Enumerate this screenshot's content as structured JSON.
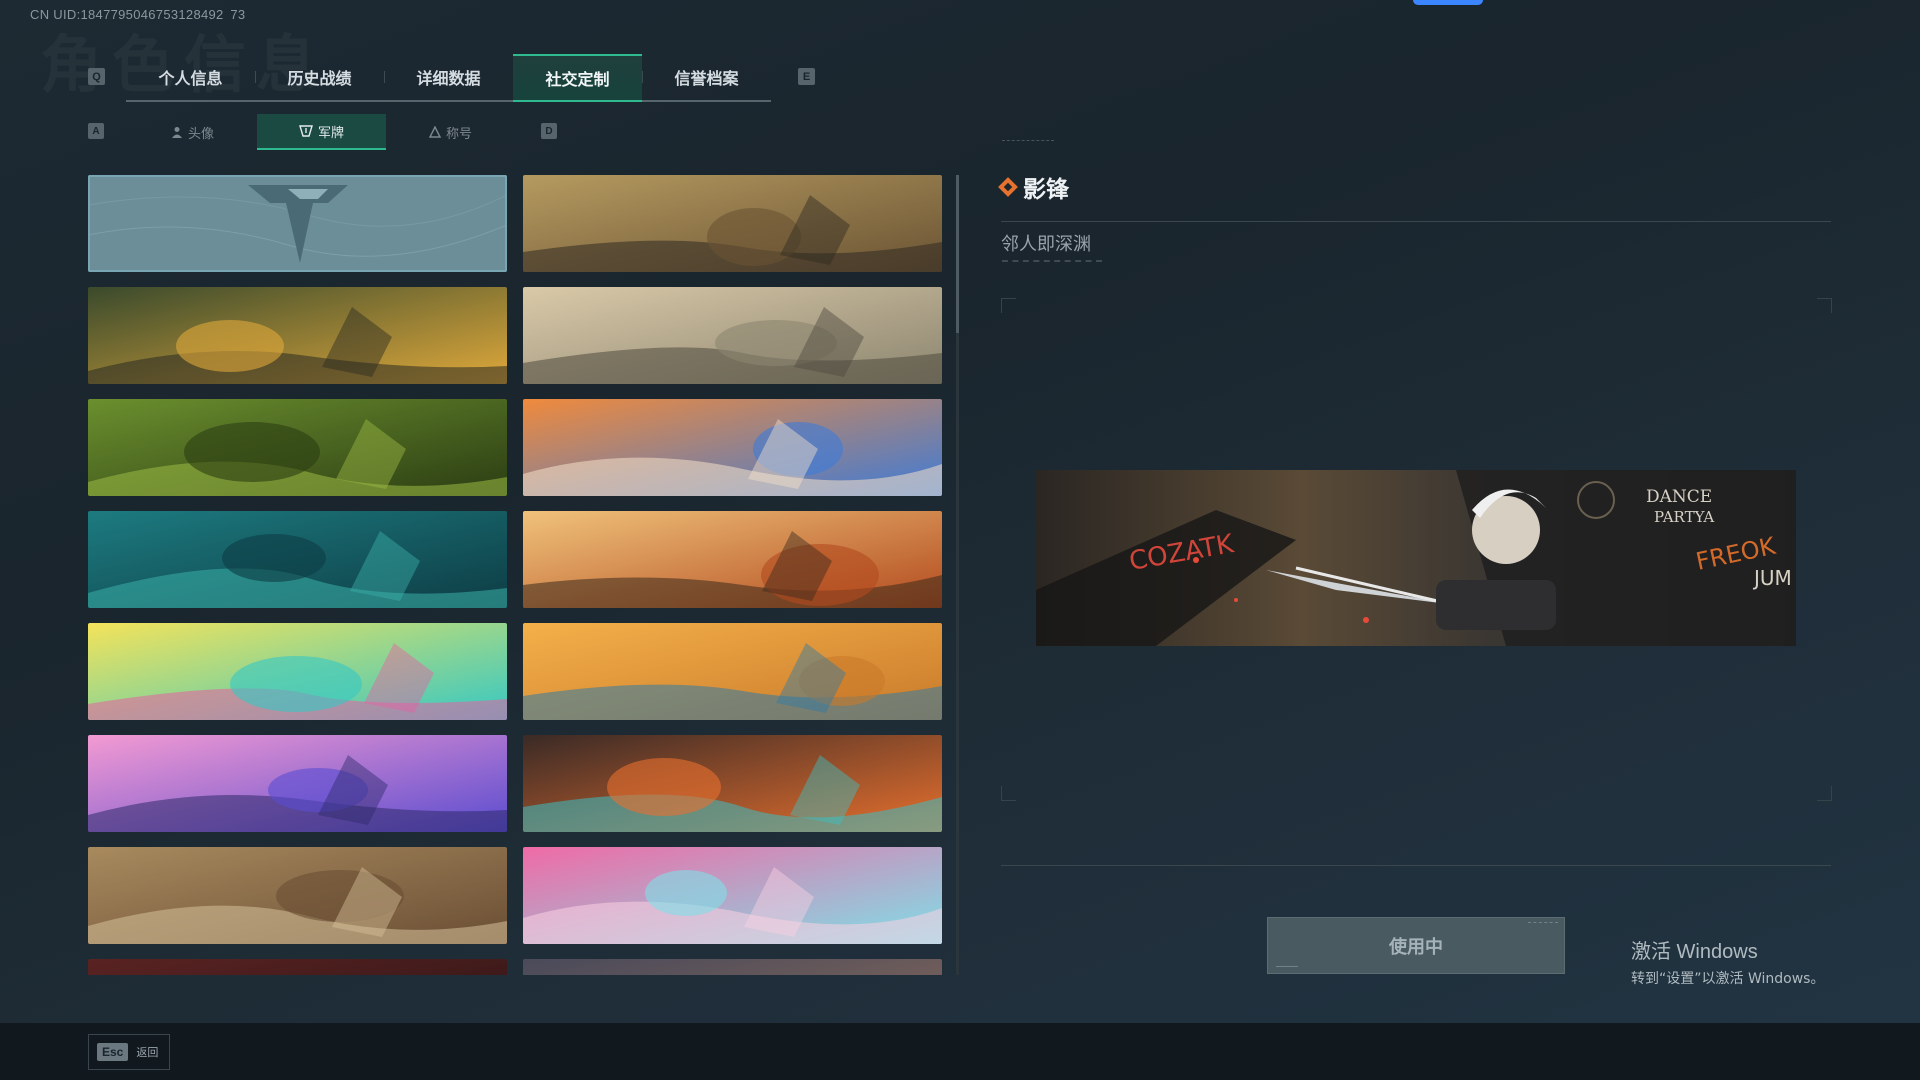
{
  "uid": "CN UID:1847795046753128492 73",
  "ghost_title": "角色信息",
  "tabs": {
    "left_key": "Q",
    "right_key": "E",
    "items": [
      {
        "label": "个人信息"
      },
      {
        "label": "历史战绩"
      },
      {
        "label": "详细数据"
      },
      {
        "label": "社交定制"
      },
      {
        "label": "信誉档案"
      }
    ],
    "active_index": 3
  },
  "subtabs": {
    "left_key": "A",
    "right_key": "D",
    "items": [
      {
        "label": "头像",
        "icon": "person-icon"
      },
      {
        "label": "军牌",
        "icon": "badge-icon"
      },
      {
        "label": "称号",
        "icon": "title-icon"
      }
    ],
    "active_index": 1
  },
  "cards": [
    {
      "theme": "tactical-logo",
      "c1": "#6c8e99",
      "c2": "#4a6a76",
      "c3": "#8fb0b8"
    },
    {
      "theme": "helicopter-desert",
      "c1": "#b59a5f",
      "c2": "#6a5334",
      "c3": "#2f2a22"
    },
    {
      "theme": "weapons-table",
      "c1": "#3a4a2c",
      "c2": "#e0a93b",
      "c3": "#2a2a22"
    },
    {
      "theme": "sniper-sunset",
      "c1": "#d9c9a8",
      "c2": "#8c8570",
      "c3": "#4e4a3e"
    },
    {
      "theme": "night-vision",
      "c1": "#6b8f2e",
      "c2": "#2b3d13",
      "c3": "#9dbb45"
    },
    {
      "theme": "blue-orange-art",
      "c1": "#f08a3c",
      "c2": "#3d7bd8",
      "c3": "#f6e2c9"
    },
    {
      "theme": "teal-gym",
      "c1": "#1c7b80",
      "c2": "#0e3c44",
      "c3": "#3bb0a8"
    },
    {
      "theme": "orange-soldiers",
      "c1": "#f0c27a",
      "c2": "#b24a1e",
      "c3": "#3a2a1c"
    },
    {
      "theme": "music-pop",
      "c1": "#f4e35a",
      "c2": "#35c8c4",
      "c3": "#e85fa4"
    },
    {
      "theme": "desert-dunes",
      "c1": "#f4b04a",
      "c2": "#c97a2a",
      "c3": "#2f7aa6"
    },
    {
      "theme": "pink-train",
      "c1": "#f39ad2",
      "c2": "#5a4cd0",
      "c3": "#2e2a6a"
    },
    {
      "theme": "feather-tribal",
      "c1": "#3a2a26",
      "c2": "#e8702e",
      "c3": "#39c0c4"
    },
    {
      "theme": "western-town",
      "c1": "#a88a5e",
      "c2": "#6a4e34",
      "c3": "#d6c19a"
    },
    {
      "theme": "hearts-girl",
      "c1": "#f06aa6",
      "c2": "#7ee0e8",
      "c3": "#fbd1e2"
    },
    {
      "theme": "dark-red",
      "c1": "#5a2222",
      "c2": "#2a1414",
      "c3": "#7a3a2a"
    },
    {
      "theme": "dusk",
      "c1": "#4a4a5a",
      "c2": "#8a6a5a",
      "c3": "#2a2a3a"
    }
  ],
  "selected_card_index": 0,
  "detail": {
    "name": "影锋",
    "subtitle": "邻人即深渊",
    "preview_texts": [
      "DANCE",
      "PARTYA",
      "COZATK",
      "FREOK",
      "JUM"
    ],
    "use_button": "使用中"
  },
  "activate": {
    "title": "激活 Windows",
    "subtitle": "转到“设置”以激活 Windows。"
  },
  "footer": {
    "esc_key": "Esc",
    "esc_label": "返回"
  },
  "colors": {
    "accent": "#2fb98f",
    "diamond": "#e6722e",
    "background": "#1d2a33"
  }
}
